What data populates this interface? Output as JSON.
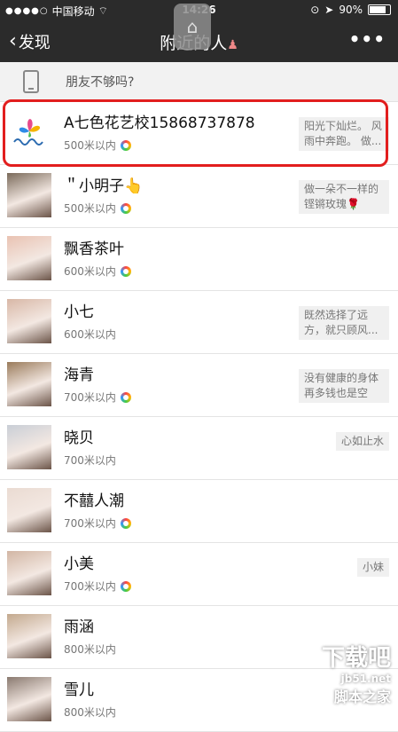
{
  "status": {
    "carrier": "中国移动",
    "time": "14:26",
    "battery": "90%",
    "battery_level": 0.9
  },
  "nav": {
    "back_label": "发现",
    "title": "附近的人"
  },
  "friends_prompt": "朋友不够吗?",
  "people": [
    {
      "name": "A七色花艺校15868737878",
      "distance": "500米以内",
      "ring": true,
      "signature": "阳光下灿烂。 风雨中奔跑。 做..."
    },
    {
      "name": "＂小明子👆",
      "distance": "500米以内",
      "ring": true,
      "signature": "做一朵不一样的铿锵玫瑰🌹"
    },
    {
      "name": "飘香茶叶",
      "distance": "600米以内",
      "ring": true,
      "signature": ""
    },
    {
      "name": "小七",
      "distance": "600米以内",
      "ring": false,
      "signature": "既然选择了远方，就只顾风..."
    },
    {
      "name": "海青",
      "distance": "700米以内",
      "ring": true,
      "signature": "没有健康的身体再多钱也是空"
    },
    {
      "name": "晓贝",
      "distance": "700米以内",
      "ring": false,
      "signature": "心如止水"
    },
    {
      "name": "不囍人潮",
      "distance": "700米以内",
      "ring": true,
      "signature": ""
    },
    {
      "name": "小美",
      "distance": "700米以内",
      "ring": true,
      "signature": "小妹"
    },
    {
      "name": "雨涵",
      "distance": "800米以内",
      "ring": false,
      "signature": ""
    },
    {
      "name": "雪儿",
      "distance": "800米以内",
      "ring": false,
      "signature": ""
    }
  ],
  "watermark": {
    "line1": "下载吧",
    "line2": "jb51.net",
    "line3": "脚本之家"
  }
}
